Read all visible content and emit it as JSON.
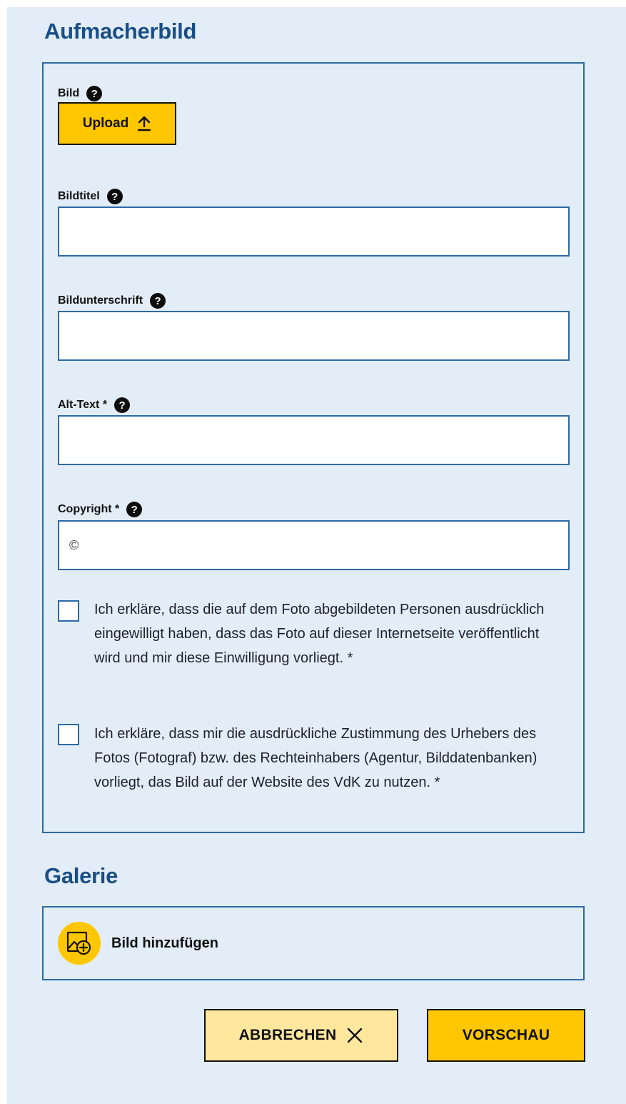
{
  "header_image": {
    "title": "Aufmacherbild",
    "image_label": "Bild",
    "upload_label": "Upload",
    "image_title_label": "Bildtitel",
    "image_title_value": "",
    "caption_label": "Bildunterschrift",
    "caption_value": "",
    "alt_text_label": "Alt-Text *",
    "alt_text_value": "",
    "copyright_label": "Copyright *",
    "copyright_value": "©",
    "consent_persons": "Ich erkläre, dass die auf dem Foto abgebildeten Personen ausdrücklich eingewilligt haben, dass das Foto auf dieser Internetseite veröffentlicht wird und mir diese Einwilligung vorliegt. *",
    "consent_rights": "Ich erkläre, dass mir die ausdrückliche Zustimmung des Urhebers des Fotos (Fotograf) bzw. des Rechteinhabers (Agentur, Bilddatenbanken) vorliegt, das Bild auf der Website des VdK zu nutzen. *"
  },
  "gallery": {
    "title": "Galerie",
    "add_label": "Bild hinzufügen"
  },
  "actions": {
    "cancel_label": "ABBRECHEN",
    "preview_label": "VORSCHAU"
  },
  "help_glyph": "?",
  "colors": {
    "background": "#e3edf7",
    "heading": "#1a4f86",
    "border": "#2b6aa6",
    "accent_yellow": "#ffc700",
    "light_yellow": "#ffe79e"
  }
}
